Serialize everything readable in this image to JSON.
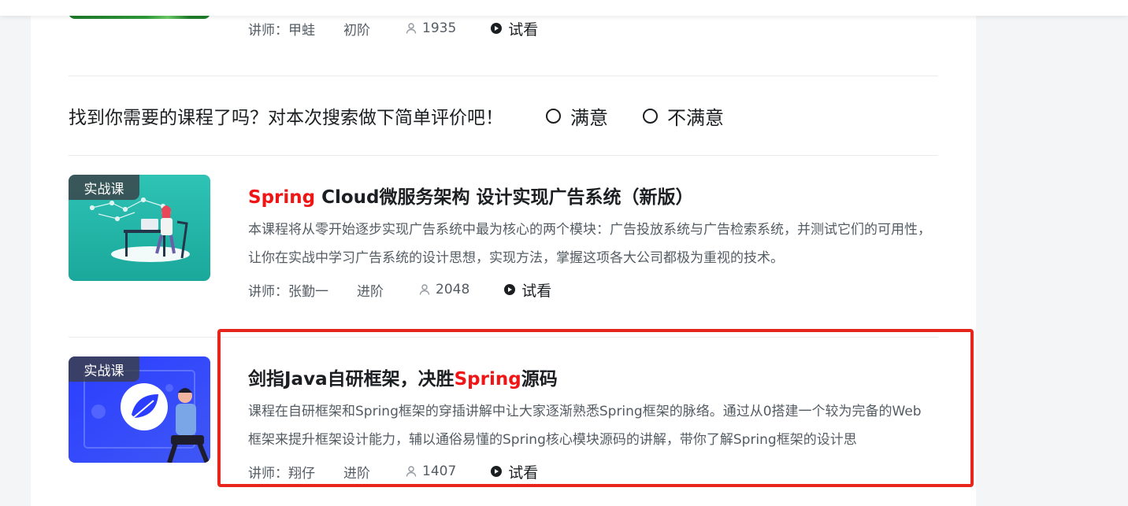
{
  "colors": {
    "accent_red": "#f01414",
    "text_primary": "#1c1f21",
    "text_secondary": "#545c63",
    "highlight_box": "#e8251c"
  },
  "previous_course": {
    "teacher": "讲师：甲蛙",
    "level": "初阶",
    "students": "1935",
    "trial": "试看"
  },
  "survey": {
    "question": "找到你需要的课程了吗？对本次搜索做下简单评价吧！",
    "option_satisfied": "满意",
    "option_unsatisfied": "不满意"
  },
  "courses": [
    {
      "tag": "实战课",
      "title_highlight": "Spring",
      "title_rest": " Cloud微服务架构 设计实现广告系统（新版）",
      "desc": "本课程将从零开始逐步实现广告系统中最为核心的两个模块：广告投放系统与广告检索系统，并测试它们的可用性，让你在实战中学习广告系统的设计思想，实现方法，掌握这项各大公司都极为重视的技术。",
      "teacher": "讲师：张勤一",
      "level": "进阶",
      "students": "2048",
      "trial": "试看"
    },
    {
      "tag": "实战课",
      "title_pre": "剑指Java自研框架，决胜",
      "title_highlight": "Spring",
      "title_post": "源码",
      "desc": "课程在自研框架和Spring框架的穿插讲解中让大家逐渐熟悉Spring框架的脉络。通过从0搭建一个较为完备的Web框架来提升框架设计能力，辅以通俗易懂的Spring核心模块源码的讲解，带你了解Spring框架的设计思",
      "teacher": "讲师：翔仔",
      "level": "进阶",
      "students": "1407",
      "trial": "试看"
    }
  ]
}
